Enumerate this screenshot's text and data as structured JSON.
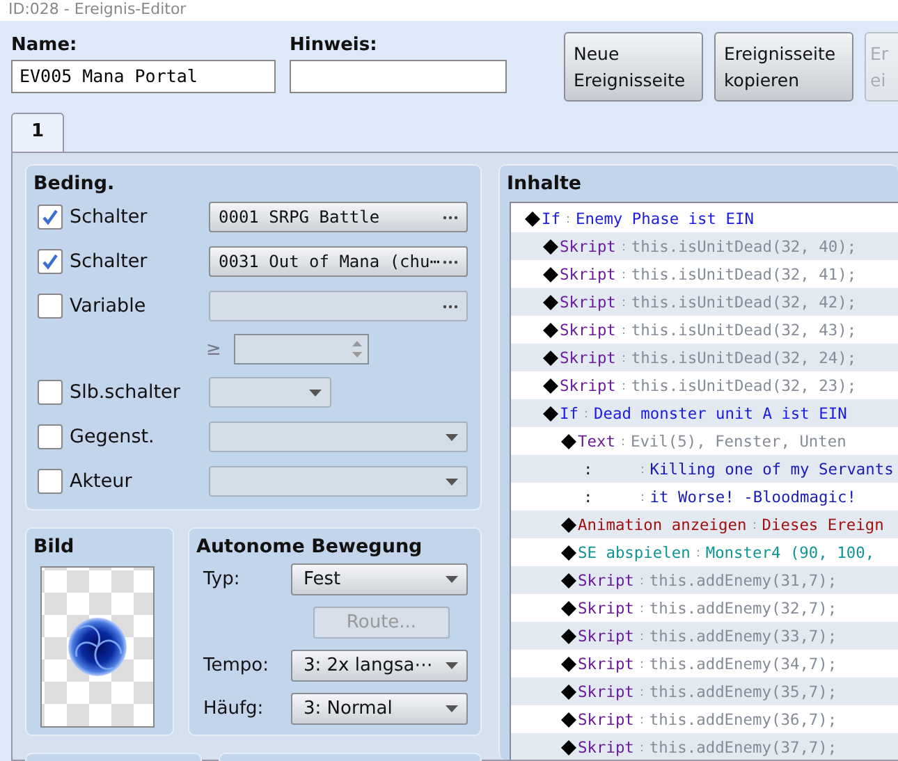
{
  "window": {
    "title": "ID:028 - Ereignis-Editor"
  },
  "name_field": {
    "label": "Name:",
    "value": "EV005 Mana Portal"
  },
  "hint_field": {
    "label": "Hinweis:"
  },
  "buttons": [
    {
      "label": "Neue Ereignisseite",
      "disabled": false
    },
    {
      "label": "Ereignisseite kopieren",
      "disabled": false
    },
    {
      "label": "Er ei",
      "disabled": true
    }
  ],
  "tabs": [
    {
      "label": "1",
      "selected": true
    }
  ],
  "conditions": {
    "title": "Beding.",
    "items": [
      {
        "kind": "picker",
        "checked": true,
        "label": "Schalter",
        "value": "0001 SRPG Battle"
      },
      {
        "kind": "picker",
        "checked": true,
        "label": "Schalter",
        "value": "0031 Out of Mana (chu⋯"
      },
      {
        "kind": "variable",
        "checked": false,
        "label": "Variable",
        "operator": "≥"
      },
      {
        "kind": "select_short",
        "checked": false,
        "label": "Slb.schalter"
      },
      {
        "kind": "select",
        "checked": false,
        "label": "Gegenst."
      },
      {
        "kind": "select",
        "checked": false,
        "label": "Akteur"
      }
    ]
  },
  "image": {
    "title": "Bild"
  },
  "movement": {
    "title": "Autonome Bewegung",
    "type": {
      "label": "Typ:",
      "value": "Fest"
    },
    "route": {
      "label": "Route...",
      "disabled": true
    },
    "speed": {
      "label": "Tempo:",
      "value": "3: 2x langsa⋯"
    },
    "frequency": {
      "label": "Häufg:",
      "value": "3: Normal"
    }
  },
  "contents": {
    "title": "Inhalte",
    "commands": [
      {
        "kind": "if",
        "label": "If",
        "sep": "：",
        "value": "Enemy Phase ist EIN",
        "children": [
          {
            "kind": "script",
            "label": "Skript",
            "sep": "：",
            "value": "this.isUnitDead(32, 40);"
          },
          {
            "kind": "script",
            "label": "Skript",
            "sep": "：",
            "value": "this.isUnitDead(32, 41);"
          },
          {
            "kind": "script",
            "label": "Skript",
            "sep": "：",
            "value": "this.isUnitDead(32, 42);"
          },
          {
            "kind": "script",
            "label": "Skript",
            "sep": "：",
            "value": "this.isUnitDead(32, 43);"
          },
          {
            "kind": "script",
            "label": "Skript",
            "sep": "：",
            "value": "this.isUnitDead(32, 24);"
          },
          {
            "kind": "script",
            "label": "Skript",
            "sep": "：",
            "value": "this.isUnitDead(32, 23);"
          },
          {
            "kind": "if",
            "label": "If",
            "sep": "：",
            "value": "Dead monster unit A ist EIN",
            "children": [
              {
                "kind": "text",
                "label": "Text",
                "sep": "：",
                "value": "Evil(5), Fenster, Unten",
                "lines": [
                  {
                    "label": ":",
                    "sep": "：",
                    "value": "Killing one of my Servants"
                  },
                  {
                    "label": ":",
                    "sep": "：",
                    "value": "it Worse! -Bloodmagic!"
                  }
                ]
              },
              {
                "kind": "animation",
                "label": "Animation anzeigen",
                "sep": "：",
                "value": "Dieses Ereign"
              },
              {
                "kind": "se",
                "label": "SE abspielen",
                "sep": "：",
                "value": "Monster4 (90, 100,"
              },
              {
                "kind": "script",
                "label": "Skript",
                "sep": "：",
                "value": "this.addEnemy(31,7);"
              },
              {
                "kind": "script",
                "label": "Skript",
                "sep": "：",
                "value": "this.addEnemy(32,7);"
              },
              {
                "kind": "script",
                "label": "Skript",
                "sep": "：",
                "value": "this.addEnemy(33,7);"
              },
              {
                "kind": "script",
                "label": "Skript",
                "sep": "：",
                "value": "this.addEnemy(34,7);"
              },
              {
                "kind": "script",
                "label": "Skript",
                "sep": "：",
                "value": "this.addEnemy(35,7);"
              },
              {
                "kind": "script",
                "label": "Skript",
                "sep": "：",
                "value": "this.addEnemy(36,7);"
              },
              {
                "kind": "script",
                "label": "Skript",
                "sep": "：",
                "value": "this.addEnemy(37,7);"
              }
            ]
          }
        ]
      }
    ]
  }
}
